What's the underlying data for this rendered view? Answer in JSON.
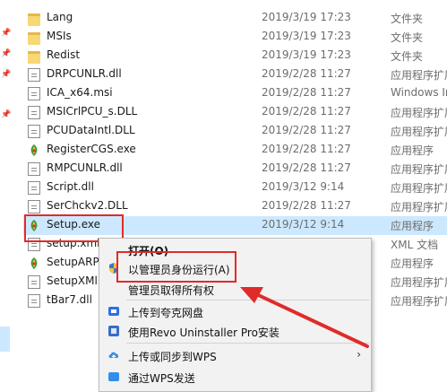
{
  "files": [
    {
      "name": "Lang",
      "date": "2019/3/19 17:23",
      "type": "文件夹",
      "icon": "folder-icon",
      "kind": "folder"
    },
    {
      "name": "MSIs",
      "date": "2019/3/19 17:23",
      "type": "文件夹",
      "icon": "folder-icon",
      "kind": "folder"
    },
    {
      "name": "Redist",
      "date": "2019/3/19 17:23",
      "type": "文件夹",
      "icon": "folder-icon",
      "kind": "folder"
    },
    {
      "name": "DRPCUNLR.dll",
      "date": "2019/2/28 11:27",
      "type": "应用程序扩展",
      "icon": "dll-file-icon",
      "kind": "file"
    },
    {
      "name": "ICA_x64.msi",
      "date": "2019/2/28 11:27",
      "type": "Windows In",
      "icon": "msi-file-icon",
      "kind": "file"
    },
    {
      "name": "MSICrlPCU_s.DLL",
      "date": "2019/2/28 11:27",
      "type": "应用程序扩展",
      "icon": "dll-file-icon",
      "kind": "file"
    },
    {
      "name": "PCUDataIntl.DLL",
      "date": "2019/2/28 11:27",
      "type": "应用程序扩展",
      "icon": "dll-file-icon",
      "kind": "file"
    },
    {
      "name": "RegisterCGS.exe",
      "date": "2019/2/28 11:27",
      "type": "应用程序",
      "icon": "app-exe-icon",
      "kind": "exe"
    },
    {
      "name": "RMPCUNLR.dll",
      "date": "2019/2/28 11:27",
      "type": "应用程序扩展",
      "icon": "dll-file-icon",
      "kind": "file"
    },
    {
      "name": "Script.dll",
      "date": "2019/3/12 9:14",
      "type": "应用程序扩展",
      "icon": "dll-file-icon",
      "kind": "file"
    },
    {
      "name": "SerChckv2.DLL",
      "date": "2019/2/28 11:27",
      "type": "应用程序扩展",
      "icon": "dll-file-icon",
      "kind": "file"
    },
    {
      "name": "Setup.exe",
      "date": "2019/3/12 9:14",
      "type": "应用程序",
      "icon": "app-exe-icon",
      "kind": "exe",
      "selected": true
    },
    {
      "name": "setup.xml",
      "date": "",
      "type": "XML 文档",
      "icon": "xml-file-icon",
      "kind": "file"
    },
    {
      "name": "SetupARP",
      "date": "",
      "type": "应用程序",
      "icon": "app-exe-icon",
      "kind": "exe"
    },
    {
      "name": "SetupXMl",
      "date": "",
      "type": "应用程序扩展",
      "icon": "dll-file-icon",
      "kind": "file"
    },
    {
      "name": "tBar7.dll",
      "date": "",
      "type": "应用程序扩展",
      "icon": "dll-file-icon",
      "kind": "file"
    }
  ],
  "context_menu": {
    "open": "打开(O)",
    "run_as_admin": "以管理员身份运行(A)",
    "take_ownership": "管理员取得所有权",
    "upload_baidu": "上传到夸克网盘",
    "revo_uninstall": "使用Revo Uninstaller Pro安装",
    "upload_wps": "上传或同步到WPS",
    "send_wps": "通过WPS发送"
  },
  "colors": {
    "selection": "#cce8ff",
    "highlight_box": "#e02b2b",
    "folder": "#f8d775"
  }
}
